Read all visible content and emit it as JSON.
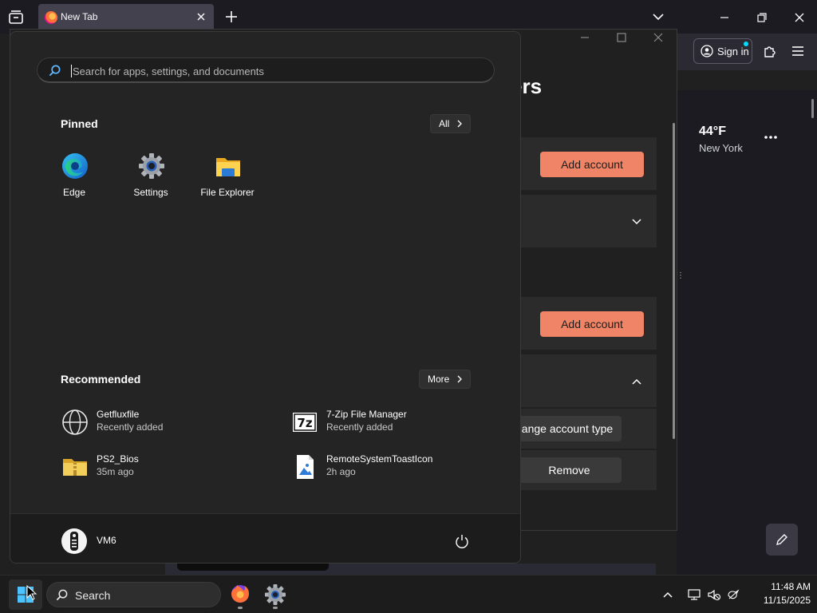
{
  "browser": {
    "tab_title": "New Tab",
    "signin_label": "Sign in",
    "weather": {
      "temp": "44°F",
      "city": "New York"
    }
  },
  "settings_window": {
    "title_fragment": "ers",
    "add_account_label": "Add account",
    "change_type_label": "ange account type",
    "remove_label": "Remove"
  },
  "start_menu": {
    "search_placeholder": "Search for apps, settings, and documents",
    "pinned_title": "Pinned",
    "all_label": "All",
    "pinned": [
      {
        "label": "Edge",
        "icon": "edge-icon"
      },
      {
        "label": "Settings",
        "icon": "settings-gear-icon"
      },
      {
        "label": "File Explorer",
        "icon": "file-explorer-icon"
      }
    ],
    "recommended_title": "Recommended",
    "more_label": "More",
    "recommended": [
      {
        "name": "Getfluxfile",
        "sub": "Recently added",
        "icon": "globe-icon"
      },
      {
        "name": "7-Zip File Manager",
        "sub": "Recently added",
        "icon": "7zip-icon"
      },
      {
        "name": "PS2_Bios",
        "sub": "35m ago",
        "icon": "zip-folder-icon"
      },
      {
        "name": "RemoteSystemToastIcon",
        "sub": "2h ago",
        "icon": "image-file-icon"
      }
    ],
    "user_name": "VM6"
  },
  "taskbar": {
    "search_label": "Search",
    "time": "11:48 AM",
    "date": "11/15/2025"
  },
  "colors": {
    "accent": "#f08466",
    "start_bg": "#242424",
    "taskbar_bg": "#1c1c1c"
  }
}
